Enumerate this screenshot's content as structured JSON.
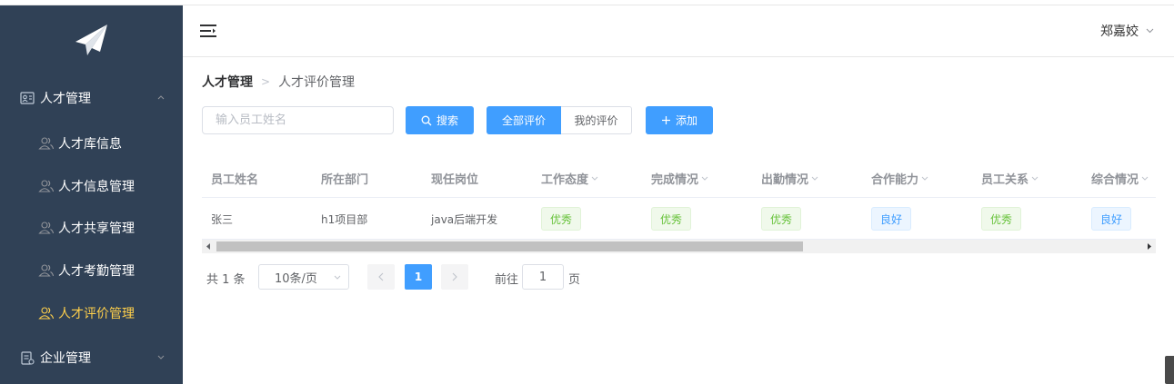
{
  "sidebar": {
    "groups": [
      {
        "label": "人才管理",
        "expanded": true,
        "items": [
          {
            "label": "人才库信息"
          },
          {
            "label": "人才信息管理"
          },
          {
            "label": "人才共享管理"
          },
          {
            "label": "人才考勤管理"
          },
          {
            "label": "人才评价管理",
            "active": true
          }
        ]
      },
      {
        "label": "企业管理",
        "expanded": false
      }
    ],
    "active_color": "#ffd04b",
    "bg_color": "#304156"
  },
  "header": {
    "user_name": "郑嘉姣",
    "menu_icon": "hamburger-icon"
  },
  "breadcrumb": {
    "items": [
      "人才管理",
      "人才评价管理"
    ]
  },
  "toolbar": {
    "search_placeholder": "输入员工姓名",
    "search_value": "",
    "search_button": "搜索",
    "filter_all": "全部评价",
    "filter_mine": "我的评价",
    "add_button": "添加"
  },
  "table": {
    "columns": [
      "员工姓名",
      "所在部门",
      "现任岗位",
      "工作态度",
      "完成情况",
      "出勤情况",
      "合作能力",
      "员工关系",
      "综合情况"
    ],
    "rows": [
      [
        "张三",
        "h1项目部",
        "java后端开发",
        "优秀",
        "优秀",
        "优秀",
        "良好",
        "优秀",
        "良好"
      ]
    ]
  },
  "pagination": {
    "total": "共 1 条",
    "page_size": "10条/页",
    "current_page": "1",
    "goto_label": "前往",
    "goto_value": "1",
    "page_suffix": "页"
  },
  "colors": {
    "primary": "#409eff",
    "success_text": "#67c23a",
    "success_bg": "#f0f9eb"
  }
}
